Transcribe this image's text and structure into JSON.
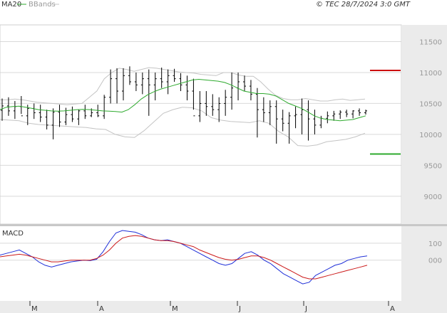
{
  "header": {
    "legend_ma": "MA20",
    "legend_bb": "BBands",
    "copyright": "© TEC 28/7/2024 3:0 GMT"
  },
  "colors": {
    "ma": "#2eaa2e",
    "bands": "#c4c4c4",
    "bars": "#000000",
    "grid": "#d9d9d9",
    "resistance": "#cc0000",
    "support": "#2eaa2e",
    "macd": "#1f2fd8",
    "signal": "#cc1a1a",
    "panel_bg": "#ebebeb"
  },
  "chart_data": [
    {
      "type": "line",
      "panel": "price",
      "x_labels": [
        "M",
        "A",
        "M",
        "J",
        "J",
        "A"
      ],
      "y_ticks": [
        "11500",
        "11000",
        "10500",
        "10000",
        "9500",
        "9000"
      ],
      "ylim": [
        8550,
        11770
      ],
      "grid": true,
      "levels": [
        {
          "name": "resistance",
          "label": "11034",
          "value": 11034
        },
        {
          "name": "support",
          "label": "9683",
          "value": 9683
        }
      ],
      "series": [
        {
          "name": "MA20",
          "values": [
            10400,
            10440,
            10450,
            10455,
            10440,
            10420,
            10400,
            10390,
            10380,
            10375,
            10380,
            10390,
            10400,
            10405,
            10400,
            10390,
            10380,
            10375,
            10370,
            10360,
            10400,
            10480,
            10570,
            10640,
            10690,
            10730,
            10760,
            10790,
            10820,
            10850,
            10880,
            10890,
            10880,
            10870,
            10860,
            10840,
            10800,
            10750,
            10700,
            10680,
            10660,
            10660,
            10650,
            10620,
            10560,
            10500,
            10460,
            10420,
            10360,
            10300,
            10260,
            10240,
            10230,
            10220,
            10230,
            10240,
            10270,
            10300
          ]
        },
        {
          "name": "BBands upper",
          "values": [
            10560,
            10560,
            10570,
            10560,
            10540,
            10520,
            10510,
            10500,
            10490,
            10480,
            10490,
            10500,
            10600,
            10700,
            10900,
            11000,
            11070,
            11050,
            11020,
            11050,
            11080,
            11070,
            11050,
            11030,
            11010,
            11000,
            10990,
            10970,
            10960,
            10950,
            11000,
            11000,
            10960,
            10940,
            10940,
            10850,
            10730,
            10630,
            10580,
            10560,
            10560,
            10580,
            10560,
            10540,
            10540,
            10560,
            10570,
            10550,
            10560,
            10570
          ]
        },
        {
          "name": "BBands lower",
          "values": [
            10240,
            10230,
            10220,
            10180,
            10160,
            10150,
            10140,
            10130,
            10120,
            10110,
            10090,
            10080,
            10000,
            9960,
            9950,
            10060,
            10200,
            10340,
            10400,
            10440,
            10430,
            10380,
            10270,
            10230,
            10210,
            10200,
            10190,
            10220,
            10180,
            10050,
            9960,
            9820,
            9810,
            9830,
            9880,
            9900,
            9920,
            9960,
            10020
          ]
        },
        {
          "name": "OHLC",
          "values": [
            [
              10390,
              10580,
              10220,
              10460
            ],
            [
              10460,
              10600,
              10300,
              10380
            ],
            [
              10380,
              10540,
              10250,
              10450
            ],
            [
              10450,
              10620,
              10330,
              10300
            ],
            [
              10300,
              10480,
              10150,
              10420
            ],
            [
              10420,
              10500,
              10250,
              10350
            ],
            [
              10350,
              10480,
              10200,
              10280
            ],
            [
              10280,
              10400,
              10080,
              10150
            ],
            [
              10150,
              10420,
              9920,
              10360
            ],
            [
              10360,
              10480,
              10120,
              10200
            ],
            [
              10200,
              10430,
              10150,
              10320
            ],
            [
              10320,
              10450,
              10200,
              10250
            ],
            [
              10250,
              10400,
              10150,
              10380
            ],
            [
              10380,
              10480,
              10250,
              10300
            ],
            [
              10300,
              10420,
              10280,
              10350
            ],
            [
              10350,
              10480,
              10280,
              10300
            ],
            [
              10300,
              10640,
              10250,
              10600
            ],
            [
              10600,
              11050,
              10500,
              10900
            ],
            [
              10900,
              11070,
              10500,
              10700
            ],
            [
              10700,
              11070,
              10550,
              10950
            ],
            [
              10950,
              11100,
              10800,
              10850
            ],
            [
              10850,
              11000,
              10700,
              10800
            ],
            [
              10800,
              11000,
              10650,
              10900
            ],
            [
              10900,
              11050,
              10300,
              10800
            ],
            [
              10800,
              11000,
              10550,
              10900
            ],
            [
              10900,
              11080,
              10750,
              10850
            ],
            [
              10850,
              11050,
              10650,
              10950
            ],
            [
              10950,
              11060,
              10850,
              10900
            ],
            [
              10900,
              10990,
              10700,
              10800
            ],
            [
              10800,
              10950,
              10550,
              10700
            ],
            [
              10700,
              10900,
              10400,
              10300
            ],
            [
              10300,
              10700,
              10200,
              10500
            ],
            [
              10500,
              10700,
              10300,
              10450
            ],
            [
              10450,
              10650,
              10300,
              10400
            ],
            [
              10400,
              10600,
              10200,
              10500
            ],
            [
              10500,
              10720,
              10300,
              10600
            ],
            [
              10600,
              11000,
              10400,
              10750
            ],
            [
              10750,
              11000,
              10550,
              10850
            ],
            [
              10850,
              10950,
              10700,
              10780
            ],
            [
              10780,
              10880,
              10550,
              10650
            ],
            [
              10650,
              10750,
              9950,
              10400
            ],
            [
              10400,
              10600,
              10200,
              10350
            ],
            [
              10350,
              10550,
              10150,
              10450
            ],
            [
              10450,
              10550,
              9850,
              10250
            ],
            [
              10250,
              10400,
              10050,
              10180
            ],
            [
              10180,
              10360,
              9850,
              10300
            ],
            [
              10300,
              10450,
              10100,
              10320
            ],
            [
              10320,
              10580,
              10000,
              10400
            ],
            [
              10400,
              10550,
              9900,
              10250
            ],
            [
              10250,
              10400,
              10000,
              10150
            ],
            [
              10150,
              10300,
              10100,
              10260
            ],
            [
              10260,
              10370,
              10180,
              10300
            ],
            [
              10300,
              10380,
              10220,
              10330
            ],
            [
              10330,
              10390,
              10250,
              10360
            ],
            [
              10360,
              10400,
              10280,
              10330
            ],
            [
              10330,
              10390,
              10260,
              10380
            ],
            [
              10380,
              10420,
              10300,
              10350
            ],
            [
              10350,
              10400,
              10320,
              10380
            ]
          ]
        }
      ]
    },
    {
      "type": "line",
      "panel": "macd",
      "title": "MACD",
      "y_ticks": [
        "100",
        "000"
      ],
      "ylim": [
        -240,
        200
      ],
      "grid": true,
      "series": [
        {
          "name": "MACD",
          "values": [
            30,
            40,
            50,
            60,
            40,
            20,
            -10,
            -30,
            -40,
            -30,
            -20,
            -10,
            -5,
            0,
            -3,
            5,
            50,
            110,
            160,
            175,
            170,
            165,
            150,
            130,
            120,
            115,
            120,
            110,
            100,
            80,
            60,
            40,
            20,
            0,
            -20,
            -30,
            -20,
            10,
            40,
            50,
            30,
            0,
            -20,
            -50,
            -80,
            -100,
            -120,
            -140,
            -130,
            -90,
            -70,
            -50,
            -30,
            -20,
            0,
            10,
            20,
            25
          ]
        },
        {
          "name": "Signal",
          "values": [
            20,
            25,
            30,
            35,
            30,
            20,
            10,
            0,
            -10,
            -10,
            -5,
            0,
            0,
            0,
            0,
            10,
            30,
            60,
            100,
            130,
            140,
            145,
            140,
            130,
            120,
            115,
            115,
            110,
            100,
            90,
            80,
            60,
            45,
            30,
            15,
            5,
            0,
            5,
            15,
            25,
            25,
            15,
            0,
            -20,
            -40,
            -60,
            -80,
            -100,
            -110,
            -110,
            -100,
            -90,
            -80,
            -70,
            -60,
            -50,
            -40,
            -30
          ]
        }
      ]
    }
  ]
}
